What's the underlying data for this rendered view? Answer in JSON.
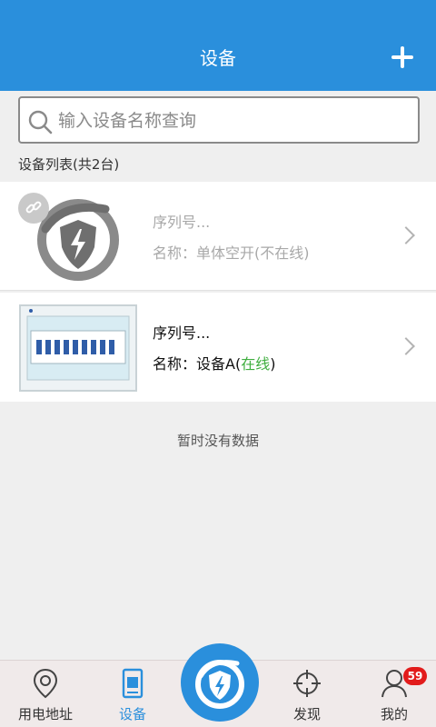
{
  "header": {
    "title": "设备"
  },
  "search": {
    "placeholder": "输入设备名称查询"
  },
  "list": {
    "title": "设备列表(共2台)"
  },
  "devices": [
    {
      "serial": "序列号...",
      "name_prefix": "名称：单体空开(不在线)",
      "status": "",
      "name_suffix": ""
    },
    {
      "serial": "序列号...",
      "name_prefix": "名称：设备A(",
      "status": "在线",
      "name_suffix": ")"
    }
  ],
  "empty_text": "暂时没有数据",
  "tabs": [
    {
      "label": "用电地址",
      "icon": "location-pin-icon"
    },
    {
      "label": "设备",
      "icon": "device-icon"
    },
    {
      "label": "发现",
      "icon": "crosshair-icon"
    },
    {
      "label": "我的",
      "icon": "user-icon"
    }
  ],
  "badge_count": "59",
  "colors": {
    "primary": "#2a8fdc",
    "online": "#3fae3f",
    "badge": "#e21b1b"
  }
}
